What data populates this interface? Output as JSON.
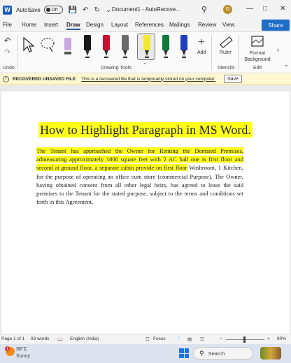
{
  "titlebar": {
    "app_logo": "W",
    "autosave_label": "AutoSave",
    "autosave_state": "Off",
    "document_title": "Document1  -  AutoRecove...",
    "avatar_initial": "G"
  },
  "menu": {
    "tabs": [
      "File",
      "Home",
      "Insert",
      "Draw",
      "Design",
      "Layout",
      "References",
      "Mailings",
      "Review",
      "View"
    ],
    "active_tab": "Draw",
    "share_label": "Share"
  },
  "ribbon": {
    "groups": [
      "Undo",
      "Drawing Tools",
      "Stencils",
      "Edit"
    ],
    "add_label": "Add",
    "ruler_label": "Ruler",
    "format_background_label": "Format Background",
    "pens": [
      {
        "name": "black-pen",
        "color": "#1a1a1a"
      },
      {
        "name": "red-pen",
        "color": "#c8102e"
      },
      {
        "name": "pencil",
        "color": "#6b6b6b"
      },
      {
        "name": "yellow-highlighter",
        "color": "#f4e733"
      },
      {
        "name": "green-pen",
        "color": "#0b7a3b"
      },
      {
        "name": "blue-pen",
        "color": "#1f3fbf"
      },
      {
        "name": "dark-red-pen",
        "color": "#a4161a"
      }
    ]
  },
  "infobar": {
    "title": "RECOVERED UNSAVED FILE",
    "message": "This is a recovered file that is temporarily stored on your computer.",
    "save_label": "Save"
  },
  "document": {
    "heading": "How to Highlight Paragraph in MS Word.",
    "highlighted_text": "The Tenant has approached the Owner for Renting the Demised Premises, admeasuring approximately 1800 square feet with 2 AC hall one is first floor and second at ground floor, a separate cabin provide on first floor",
    "rest_text": " Washroom, 1 Kitchen, for the purpose of operating an office cum store (commercial Purpose). The Owner, having obtained consent from all other legal heirs, has agreed to lease the said premises to the Tenant for the stated purpose, subject to the terms and conditions set forth in this Agreement.",
    "highlight_color": "#ffff1a"
  },
  "status": {
    "page": "Page 1 of 1",
    "words": "93 words",
    "language": "English (India)",
    "focus": "Focus",
    "zoom": "90%"
  },
  "taskbar": {
    "temperature": "30°C",
    "condition": "Sunny",
    "search_placeholder": "Search",
    "weather_badge": "1"
  },
  "colors": {
    "accent": "#2b579a",
    "share": "#1e6ec8",
    "infobar_bg": "#fff7d1"
  }
}
